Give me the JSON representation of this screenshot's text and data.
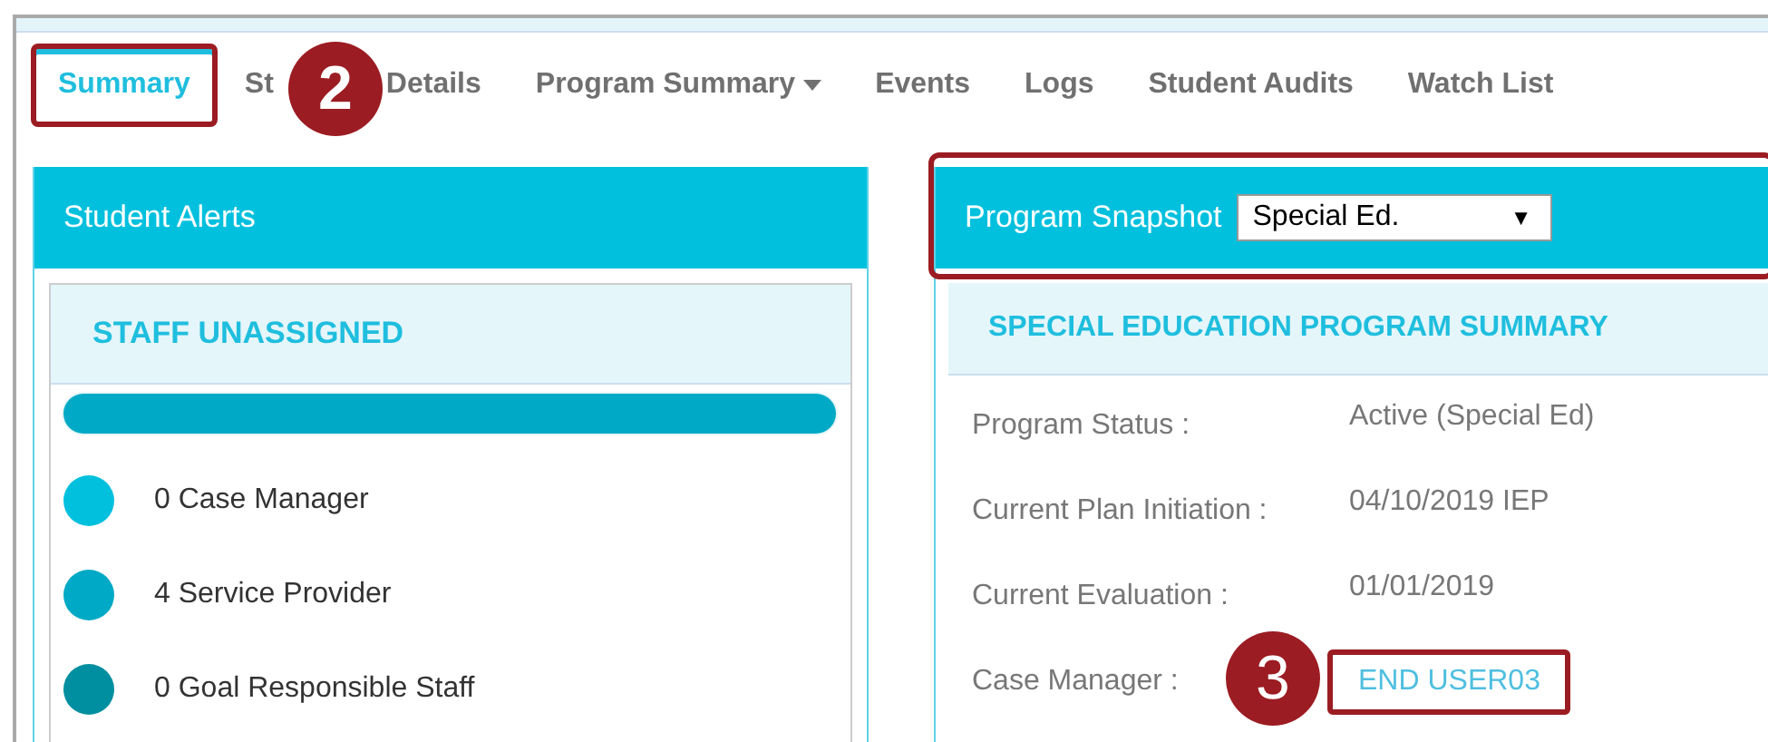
{
  "tabs": [
    {
      "label": "Summary",
      "selected": true,
      "highlighted": true
    },
    {
      "label": "St",
      "label_after": "Details",
      "selected": false,
      "highlighted": false,
      "callout": "2"
    },
    {
      "label": "Program Summary",
      "selected": false,
      "highlighted": false,
      "dropdown": true
    },
    {
      "label": "Events",
      "selected": false,
      "highlighted": false
    },
    {
      "label": "Logs",
      "selected": false,
      "highlighted": false
    },
    {
      "label": "Student Audits",
      "selected": false,
      "highlighted": false
    },
    {
      "label": "Watch List",
      "selected": false,
      "highlighted": false
    }
  ],
  "student_alerts": {
    "title": "Student Alerts",
    "card": {
      "title": "STAFF UNASSIGNED",
      "level": 1,
      "items": [
        {
          "label": "0 Case Manager",
          "color": "#00c0de"
        },
        {
          "label": "4 Service Provider",
          "color": "#00a9c5"
        },
        {
          "label": "0 Goal Responsible Staff",
          "color": "#008fa0"
        }
      ]
    }
  },
  "program_snapshot": {
    "title": "Program Snapshot",
    "highlighted": true,
    "select_value": "Special Ed.",
    "select_arrow": "▼",
    "summary_title": "SPECIAL EDUCATION PROGRAM SUMMARY",
    "fields": [
      {
        "label": "Program Status :",
        "value": "Active (Special Ed)",
        "kind": "text"
      },
      {
        "label": "Current Plan Initiation :",
        "value": "04/10/2019 IEP",
        "kind": "text"
      },
      {
        "label": "Current Evaluation :",
        "value": "01/01/2019",
        "kind": "text"
      },
      {
        "label": "Case Manager :",
        "value": "END USER03",
        "kind": "link",
        "highlighted": true,
        "callout": "3"
      }
    ]
  }
}
